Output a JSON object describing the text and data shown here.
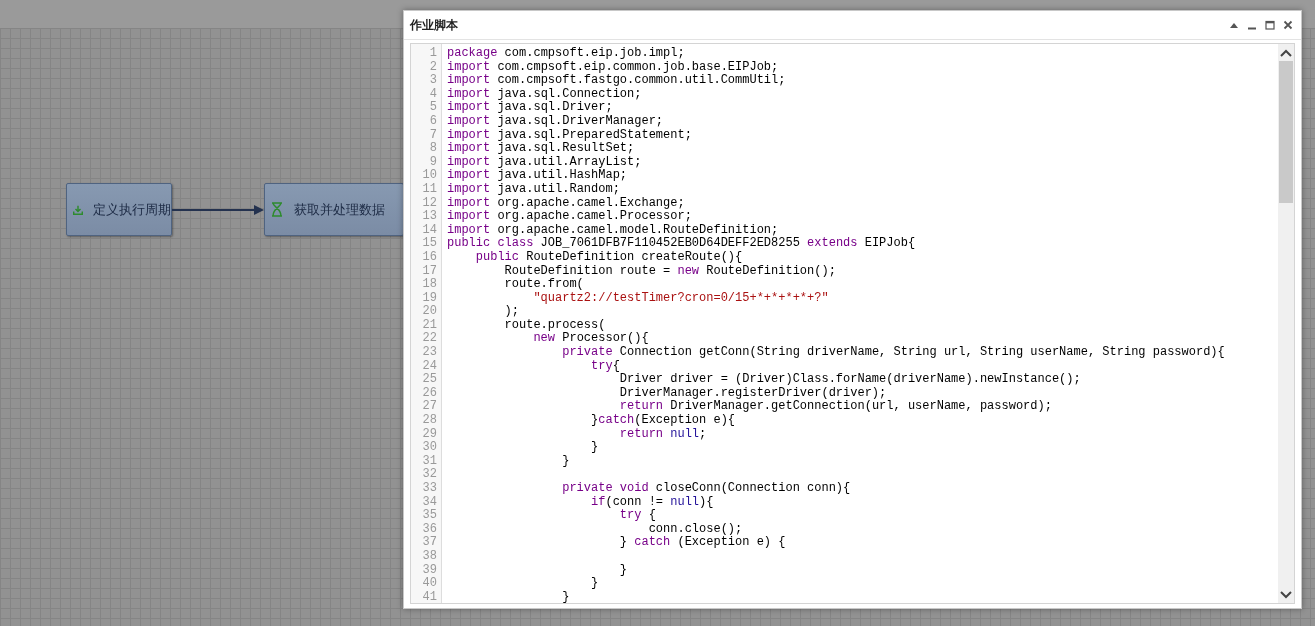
{
  "canvas": {
    "nodes": [
      {
        "label": "定义执行周期",
        "kind": "trigger"
      },
      {
        "label": "获取并处理数据",
        "kind": "process"
      }
    ]
  },
  "dialog": {
    "title": "作业脚本",
    "lines": [
      {
        "number": "1",
        "tokens": [
          {
            "kind": "keyword",
            "text": "package"
          },
          {
            "kind": "plain",
            "text": " com.cmpsoft.eip.job.impl;"
          }
        ]
      },
      {
        "number": "2",
        "tokens": [
          {
            "kind": "keyword",
            "text": "import"
          },
          {
            "kind": "plain",
            "text": " com.cmpsoft.eip.common.job.base.EIPJob;"
          }
        ]
      },
      {
        "number": "3",
        "tokens": [
          {
            "kind": "keyword",
            "text": "import"
          },
          {
            "kind": "plain",
            "text": " com.cmpsoft.fastgo.common.util.CommUtil;"
          }
        ]
      },
      {
        "number": "4",
        "tokens": [
          {
            "kind": "keyword",
            "text": "import"
          },
          {
            "kind": "plain",
            "text": " java.sql.Connection;"
          }
        ]
      },
      {
        "number": "5",
        "tokens": [
          {
            "kind": "keyword",
            "text": "import"
          },
          {
            "kind": "plain",
            "text": " java.sql.Driver;"
          }
        ]
      },
      {
        "number": "6",
        "tokens": [
          {
            "kind": "keyword",
            "text": "import"
          },
          {
            "kind": "plain",
            "text": " java.sql.DriverManager;"
          }
        ]
      },
      {
        "number": "7",
        "tokens": [
          {
            "kind": "keyword",
            "text": "import"
          },
          {
            "kind": "plain",
            "text": " java.sql.PreparedStatement;"
          }
        ]
      },
      {
        "number": "8",
        "tokens": [
          {
            "kind": "keyword",
            "text": "import"
          },
          {
            "kind": "plain",
            "text": " java.sql.ResultSet;"
          }
        ]
      },
      {
        "number": "9",
        "tokens": [
          {
            "kind": "keyword",
            "text": "import"
          },
          {
            "kind": "plain",
            "text": " java.util.ArrayList;"
          }
        ]
      },
      {
        "number": "10",
        "tokens": [
          {
            "kind": "keyword",
            "text": "import"
          },
          {
            "kind": "plain",
            "text": " java.util.HashMap;"
          }
        ]
      },
      {
        "number": "11",
        "tokens": [
          {
            "kind": "keyword",
            "text": "import"
          },
          {
            "kind": "plain",
            "text": " java.util.Random;"
          }
        ]
      },
      {
        "number": "12",
        "tokens": [
          {
            "kind": "keyword",
            "text": "import"
          },
          {
            "kind": "plain",
            "text": " org.apache.camel.Exchange;"
          }
        ]
      },
      {
        "number": "13",
        "tokens": [
          {
            "kind": "keyword",
            "text": "import"
          },
          {
            "kind": "plain",
            "text": " org.apache.camel.Processor;"
          }
        ]
      },
      {
        "number": "14",
        "tokens": [
          {
            "kind": "keyword",
            "text": "import"
          },
          {
            "kind": "plain",
            "text": " org.apache.camel.model.RouteDefinition;"
          }
        ]
      },
      {
        "number": "15",
        "tokens": [
          {
            "kind": "keyword",
            "text": "public class"
          },
          {
            "kind": "plain",
            "text": " JOB_7061DFB7F110452EB0D64DEFF2ED8255 "
          },
          {
            "kind": "keyword",
            "text": "extends"
          },
          {
            "kind": "plain",
            "text": " EIPJob{"
          }
        ]
      },
      {
        "number": "16",
        "tokens": [
          {
            "kind": "keyword",
            "text": "    public"
          },
          {
            "kind": "plain",
            "text": " RouteDefinition createRoute(){"
          }
        ]
      },
      {
        "number": "17",
        "tokens": [
          {
            "kind": "plain",
            "text": "        RouteDefinition route = "
          },
          {
            "kind": "keyword",
            "text": "new"
          },
          {
            "kind": "plain",
            "text": " RouteDefinition();"
          }
        ]
      },
      {
        "number": "18",
        "tokens": [
          {
            "kind": "plain",
            "text": "        route.from("
          }
        ]
      },
      {
        "number": "19",
        "tokens": [
          {
            "kind": "string",
            "text": "            \"quartz2://testTimer?cron=0/15+*+*+*+*+?\""
          }
        ]
      },
      {
        "number": "20",
        "tokens": [
          {
            "kind": "plain",
            "text": "        );"
          }
        ]
      },
      {
        "number": "21",
        "tokens": [
          {
            "kind": "plain",
            "text": "        route.process("
          }
        ]
      },
      {
        "number": "22",
        "tokens": [
          {
            "kind": "keyword",
            "text": "            new"
          },
          {
            "kind": "plain",
            "text": " Processor(){"
          }
        ]
      },
      {
        "number": "23",
        "tokens": [
          {
            "kind": "keyword",
            "text": "                private"
          },
          {
            "kind": "plain",
            "text": " Connection getConn(String driverName, String url, String userName, String password){"
          }
        ]
      },
      {
        "number": "24",
        "tokens": [
          {
            "kind": "keyword",
            "text": "                    try"
          },
          {
            "kind": "plain",
            "text": "{"
          }
        ]
      },
      {
        "number": "25",
        "tokens": [
          {
            "kind": "plain",
            "text": "                        Driver driver = (Driver)Class.forName(driverName).newInstance();"
          }
        ]
      },
      {
        "number": "26",
        "tokens": [
          {
            "kind": "plain",
            "text": "                        DriverManager.registerDriver(driver);"
          }
        ]
      },
      {
        "number": "27",
        "tokens": [
          {
            "kind": "keyword",
            "text": "                        return"
          },
          {
            "kind": "plain",
            "text": " DriverManager.getConnection(url, userName, password);"
          }
        ]
      },
      {
        "number": "28",
        "tokens": [
          {
            "kind": "plain",
            "text": "                    }"
          },
          {
            "kind": "keyword",
            "text": "catch"
          },
          {
            "kind": "plain",
            "text": "(Exception e){"
          }
        ]
      },
      {
        "number": "29",
        "tokens": [
          {
            "kind": "keyword",
            "text": "                        return"
          },
          {
            "kind": "atom",
            "text": " null"
          },
          {
            "kind": "plain",
            "text": ";"
          }
        ]
      },
      {
        "number": "30",
        "tokens": [
          {
            "kind": "plain",
            "text": "                    }"
          }
        ]
      },
      {
        "number": "31",
        "tokens": [
          {
            "kind": "plain",
            "text": "                }"
          }
        ]
      },
      {
        "number": "32"
      },
      {
        "number": "33",
        "tokens": [
          {
            "kind": "keyword",
            "text": "                private void"
          },
          {
            "kind": "plain",
            "text": " closeConn(Connection conn){"
          }
        ]
      },
      {
        "number": "34",
        "tokens": [
          {
            "kind": "keyword",
            "text": "                    if"
          },
          {
            "kind": "plain",
            "text": "(conn != "
          },
          {
            "kind": "atom",
            "text": "null"
          },
          {
            "kind": "plain",
            "text": "){"
          }
        ]
      },
      {
        "number": "35",
        "tokens": [
          {
            "kind": "keyword",
            "text": "                        try"
          },
          {
            "kind": "plain",
            "text": " {"
          }
        ]
      },
      {
        "number": "36",
        "tokens": [
          {
            "kind": "plain",
            "text": "                            conn.close();"
          }
        ]
      },
      {
        "number": "37",
        "tokens": [
          {
            "kind": "plain",
            "text": "                        } "
          },
          {
            "kind": "keyword",
            "text": "catch"
          },
          {
            "kind": "plain",
            "text": " (Exception e) {"
          }
        ]
      },
      {
        "number": "38"
      },
      {
        "number": "39",
        "tokens": [
          {
            "kind": "plain",
            "text": "                        }"
          }
        ]
      },
      {
        "number": "40",
        "tokens": [
          {
            "kind": "plain",
            "text": "                    }"
          }
        ]
      },
      {
        "number": "41",
        "tokens": [
          {
            "kind": "plain",
            "text": "                }"
          }
        ]
      }
    ]
  }
}
